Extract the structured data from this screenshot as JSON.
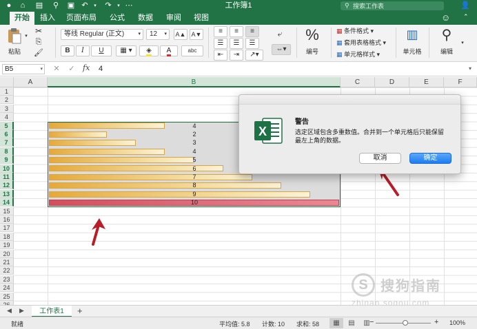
{
  "window": {
    "title": "工作簿1"
  },
  "search": {
    "placeholder": "搜索工作表"
  },
  "tabs": [
    "开始",
    "插入",
    "页面布局",
    "公式",
    "数据",
    "审阅",
    "视图"
  ],
  "ribbon": {
    "paste_label": "粘贴",
    "font_name": "等线 Regular (正文)",
    "font_size": "12",
    "grow_font": "A▲",
    "shrink_font": "A▼",
    "bold": "B",
    "italic": "I",
    "underline": "U",
    "phonetic": "abc",
    "number_label": "编号",
    "percent": "%",
    "conditional_format": "条件格式",
    "format_as_table": "套用表格格式",
    "cell_styles": "单元格样式",
    "cells_label": "单元格",
    "editing_label": "编辑"
  },
  "formula_bar": {
    "name_box": "B5",
    "value": "4",
    "fx": "fx"
  },
  "columns": [
    "A",
    "B",
    "C",
    "D",
    "E",
    "F"
  ],
  "rows": [
    "1",
    "2",
    "3",
    "4",
    "5",
    "6",
    "7",
    "8",
    "9",
    "10",
    "11",
    "12",
    "13",
    "14",
    "15",
    "16",
    "17",
    "18",
    "19",
    "20",
    "21",
    "22",
    "23",
    "24",
    "25",
    "26"
  ],
  "bar_values": [
    {
      "label": "4",
      "value": 4
    },
    {
      "label": "2",
      "value": 2
    },
    {
      "label": "3",
      "value": 3
    },
    {
      "label": "4",
      "value": 4
    },
    {
      "label": "5",
      "value": 5
    },
    {
      "label": "6",
      "value": 6
    },
    {
      "label": "7",
      "value": 7
    },
    {
      "label": "8",
      "value": 8
    },
    {
      "label": "9",
      "value": 9
    },
    {
      "label": "10",
      "value": 10
    }
  ],
  "dialog": {
    "title": "警告",
    "message": "选定区域包含多重数值。合并到一个单元格后只能保留最左上角的数据。",
    "cancel": "取消",
    "ok": "确定",
    "icon_letter": "X"
  },
  "sheets": {
    "tab": "工作表1",
    "add": "+"
  },
  "status": {
    "ready": "就绪",
    "average": "平均值: 5.8",
    "count": "计数: 10",
    "sum": "求和: 58",
    "zoom": "100%",
    "zoom_minus": "−",
    "zoom_plus": "+"
  },
  "watermark": {
    "text": "搜狗指南",
    "url": "zhinan.sogou.com",
    "logo": "S"
  },
  "colors": {
    "excel_green": "#217346",
    "bar_gold": "#e5a93a",
    "bar_red": "#d0505f",
    "ok_blue": "#1c7cf0",
    "arrow_red": "#b81e2a"
  }
}
